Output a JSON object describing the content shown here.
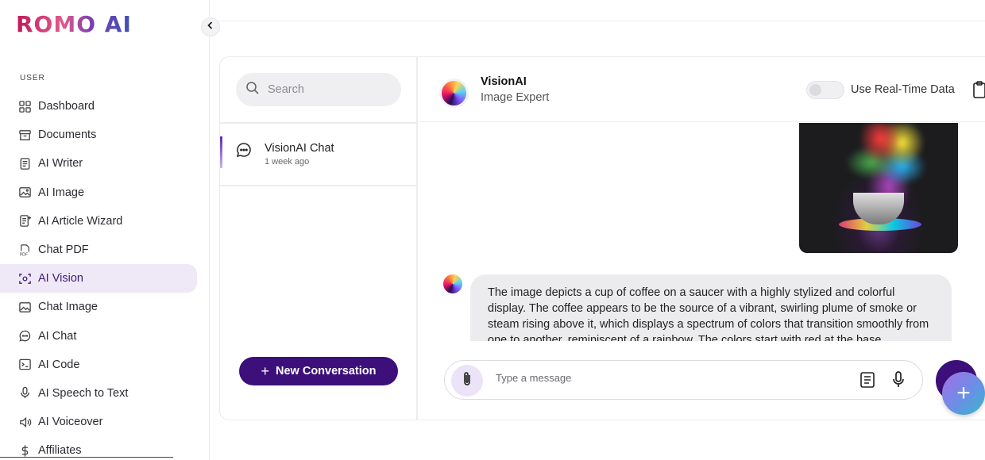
{
  "app": {
    "logo": "ROMO AI"
  },
  "sidebar": {
    "section_label": "USER",
    "items": [
      {
        "label": "Dashboard",
        "icon": "dashboard-icon"
      },
      {
        "label": "Documents",
        "icon": "archive-icon"
      },
      {
        "label": "AI Writer",
        "icon": "document-icon"
      },
      {
        "label": "AI Image",
        "icon": "image-icon"
      },
      {
        "label": "AI Article Wizard",
        "icon": "article-wizard-icon"
      },
      {
        "label": "Chat PDF",
        "icon": "pdf-icon"
      },
      {
        "label": "AI Vision",
        "icon": "vision-scan-icon",
        "active": true
      },
      {
        "label": "Chat Image",
        "icon": "chat-image-icon"
      },
      {
        "label": "AI Chat",
        "icon": "chat-bubble-icon"
      },
      {
        "label": "AI Code",
        "icon": "terminal-icon"
      },
      {
        "label": "AI Speech to Text",
        "icon": "microphone-icon"
      },
      {
        "label": "AI Voiceover",
        "icon": "speaker-icon"
      },
      {
        "label": "Affiliates",
        "icon": "dollar-icon"
      }
    ]
  },
  "chat_list": {
    "search_placeholder": "Search",
    "conversations": [
      {
        "title": "VisionAI Chat",
        "time": "1 week ago"
      }
    ],
    "new_conversation_label": "New Conversation"
  },
  "chat": {
    "bot_name": "VisionAI",
    "bot_role": "Image Expert",
    "realtime_label": "Use Real-Time Data",
    "realtime_enabled": false,
    "assistant_message": "The image depicts a cup of coffee on a saucer with a highly stylized and colorful display. The coffee appears to be the source of a vibrant, swirling plume of smoke or steam rising above it, which displays a spectrum of colors that transition smoothly from one to another, reminiscent of a rainbow. The colors start with red at the base",
    "composer_placeholder": "Type a message"
  },
  "colors": {
    "brand_primary": "#3c0f7a",
    "active_nav_bg": "#efe9f7",
    "attach_bg": "#ede3f8"
  }
}
